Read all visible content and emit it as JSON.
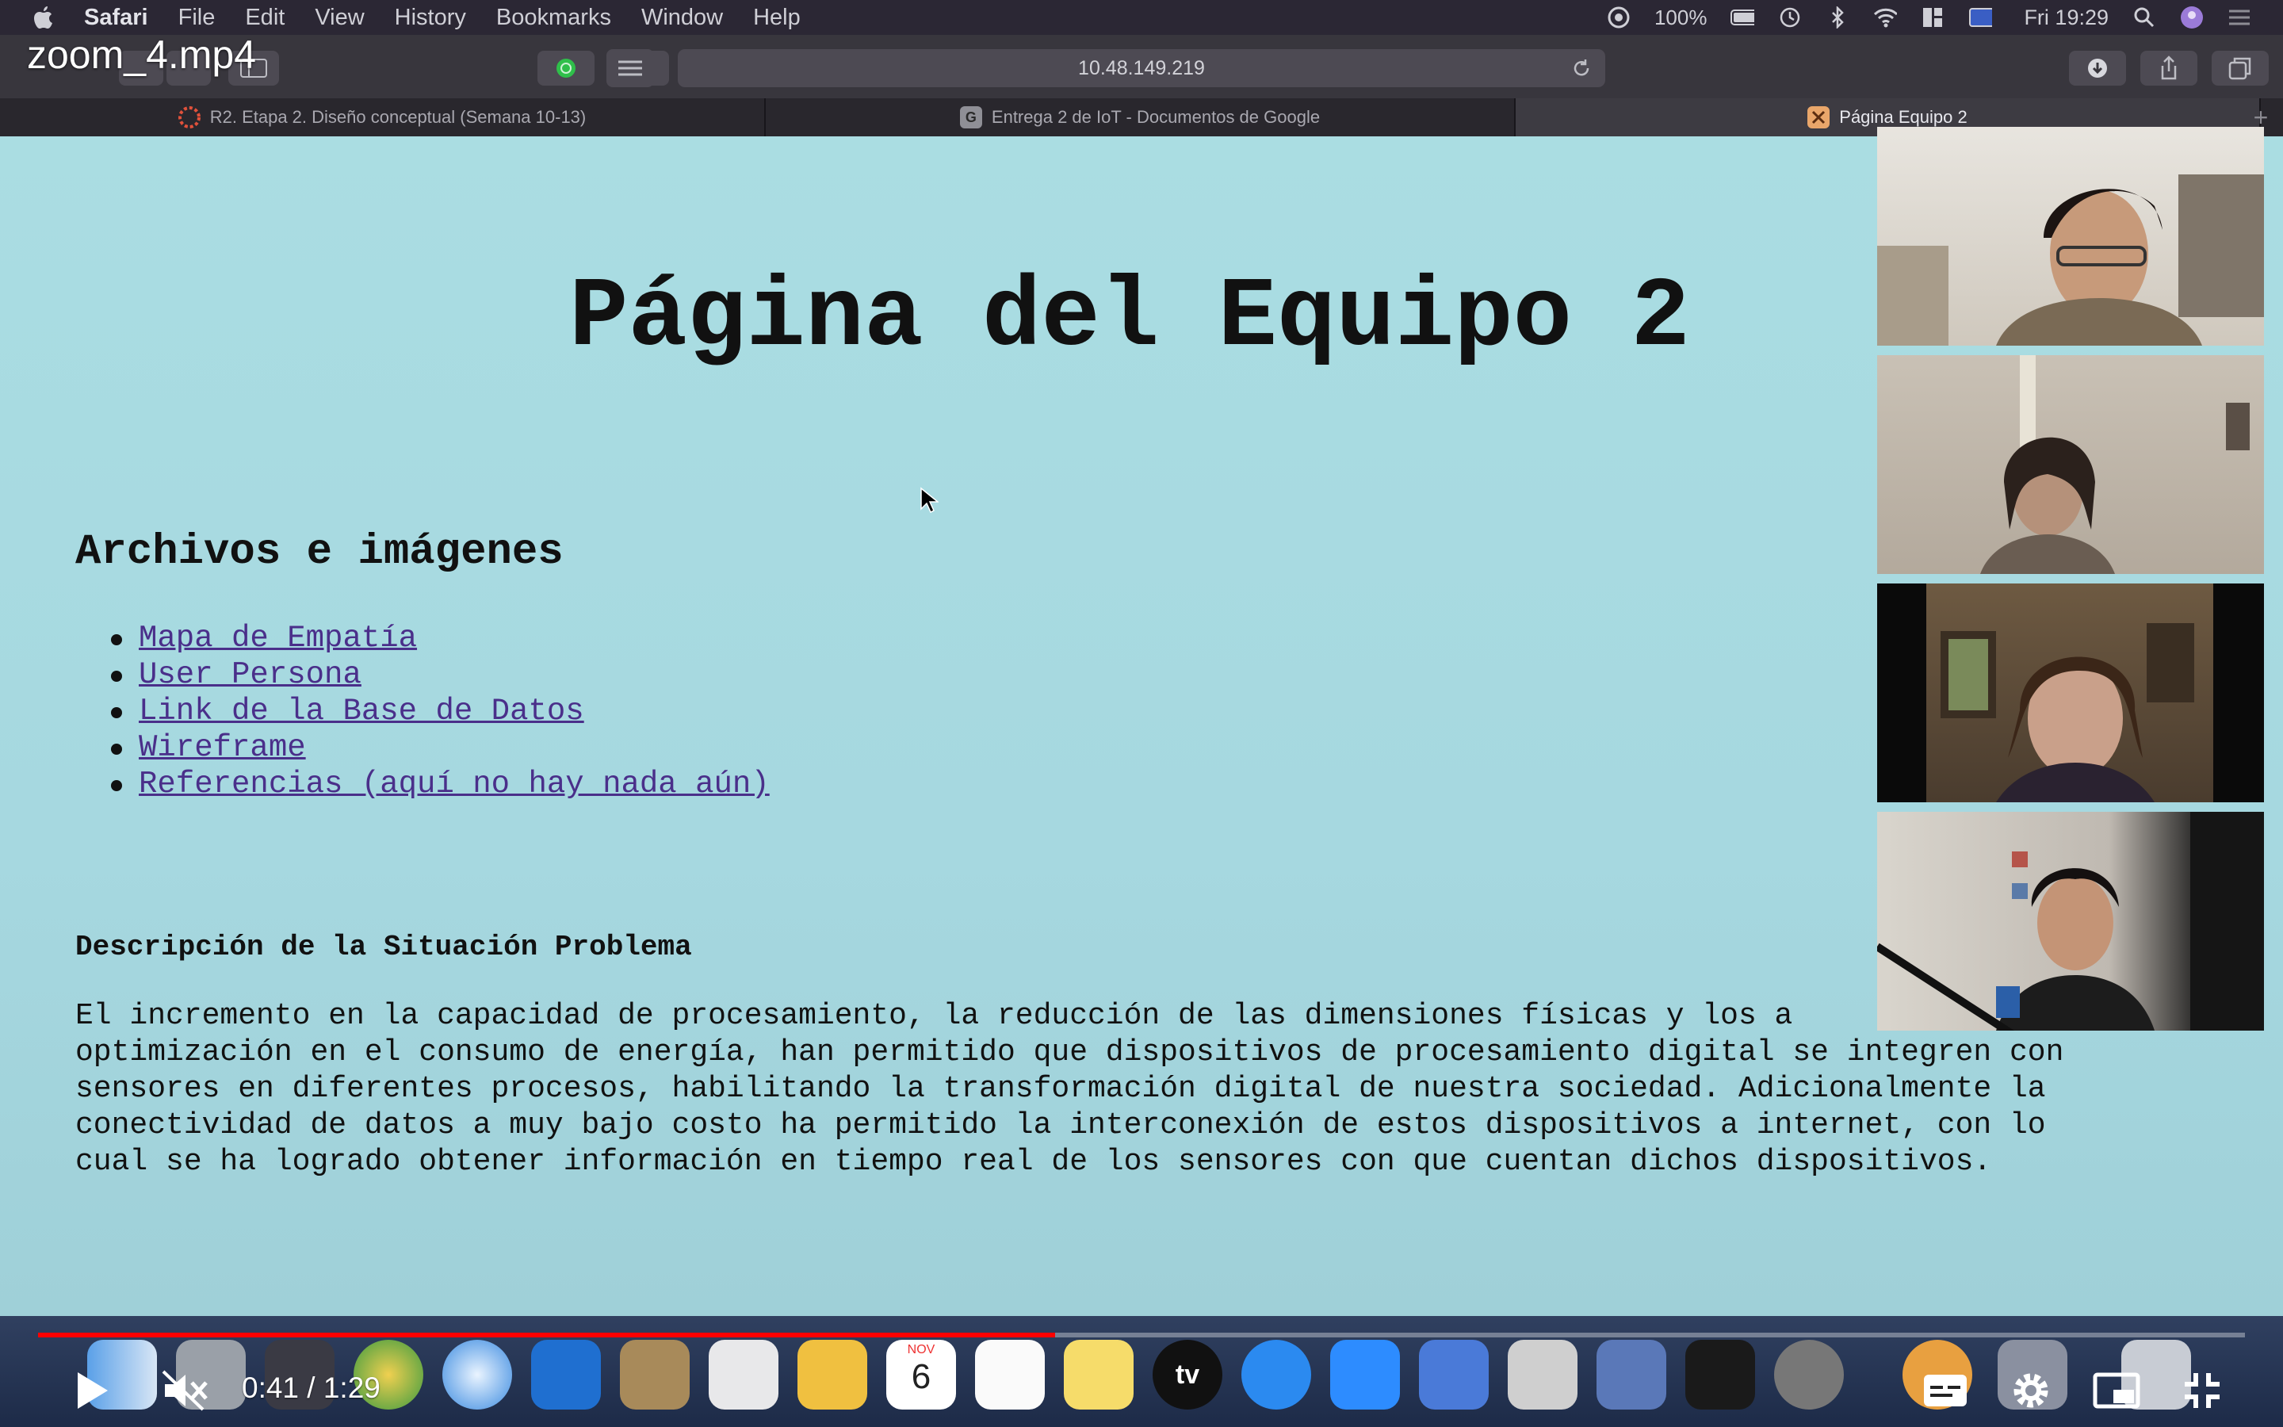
{
  "video": {
    "filename": "zoom_4.mp4",
    "current_time": "0:41",
    "duration": "1:29",
    "progress": 0.4607
  },
  "menubar": {
    "app_name": "Safari",
    "items": [
      "File",
      "Edit",
      "View",
      "History",
      "Bookmarks",
      "Window",
      "Help"
    ],
    "battery": "100%",
    "clock": "Fri 19:29"
  },
  "toolbar": {
    "url": "10.48.149.219"
  },
  "tabs": [
    {
      "label": "R2. Etapa 2. Diseño conceptual (Semana 10-13)",
      "favicon": "canvas-icon",
      "active": false
    },
    {
      "label": "Entrega 2 de IoT - Documentos de Google",
      "favicon": "google-docs-icon",
      "favicon_text": "G",
      "active": false
    },
    {
      "label": "Página Equipo 2",
      "favicon": "page-icon",
      "active": true
    }
  ],
  "page": {
    "title": "Página del Equipo 2",
    "files_heading": "Archivos e imágenes",
    "links": [
      "Mapa de Empatía",
      "User Persona",
      "Link de la Base de Datos",
      "Wireframe",
      "Referencias (aquí no hay nada aún)"
    ],
    "description_heading": "Descripción de la Situación Problema",
    "description_lines": [
      "El incremento en la capacidad de procesamiento, la reducción de las dimensiones físicas y los a",
      "optimización en el consumo de energía, han permitido que dispositivos de procesamiento digital se integren con",
      "sensores en diferentes procesos, habilitando la transformación digital de nuestra sociedad. Adicionalmente la",
      "conectividad de datos a muy bajo costo ha permitido la interconexión de estos dispositivos a internet, con lo",
      "cual se ha logrado obtener información en tiempo real de los sensores con que cuentan dichos dispositivos."
    ]
  },
  "participants": [
    "participant-1",
    "participant-2",
    "participant-3",
    "participant-4"
  ],
  "dock": {
    "calendar_month": "NOV",
    "calendar_day": "6",
    "tv_label": "tv"
  },
  "colors": {
    "page_bg": "#aadde2",
    "link": "#4a2f8a",
    "progress": "#ff0000"
  }
}
